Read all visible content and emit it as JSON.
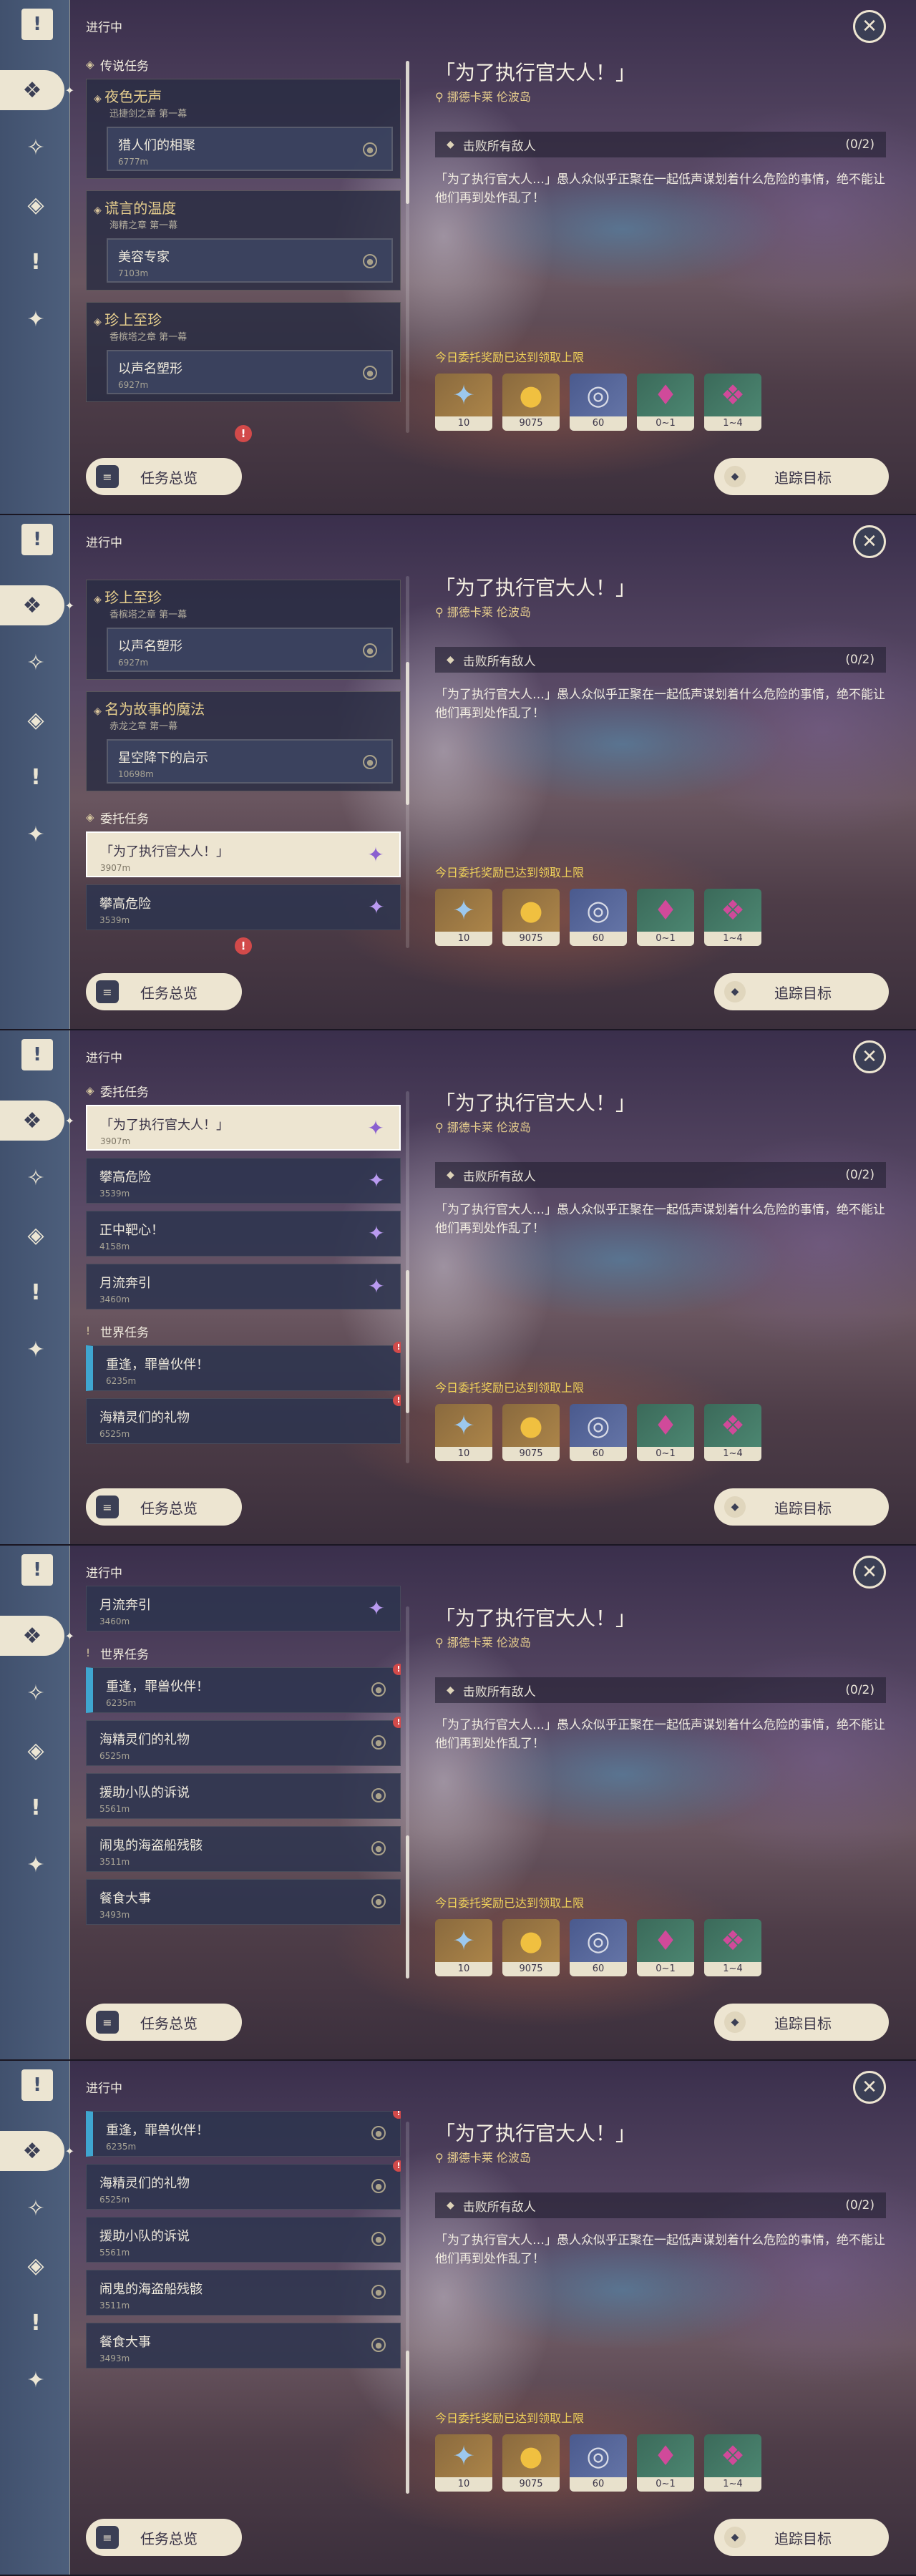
{
  "ui": {
    "header": "进行中",
    "overview_button": "任务总览",
    "track_button": "追踪目标",
    "close_icon": "✕"
  },
  "sections": {
    "legend": "传说任务",
    "commission": "委托任务",
    "world": "世界任务"
  },
  "legend_quests": [
    {
      "title": "夜色无声",
      "chapter": "迅捷剑之章 第一幕",
      "step": "猎人们的相聚",
      "dist": "6777m"
    },
    {
      "title": "谎言的温度",
      "chapter": "海精之章 第一幕",
      "step": "美容专家",
      "dist": "7103m"
    },
    {
      "title": "珍上至珍",
      "chapter": "香槟塔之章 第一幕",
      "step": "以声名塑形",
      "dist": "6927m"
    },
    {
      "title": "名为故事的魔法",
      "chapter": "赤龙之章 第一幕",
      "step": "星空降下的启示",
      "dist": "10698m"
    }
  ],
  "commissions": [
    {
      "name": "「为了执行官大人！」",
      "dist": "3907m"
    },
    {
      "name": "攀高危险",
      "dist": "3539m"
    },
    {
      "name": "正中靶心！",
      "dist": "4158m"
    },
    {
      "name": "月流奔引",
      "dist": "3460m"
    }
  ],
  "world_quests": [
    {
      "name": "重逢，罪兽伙伴！",
      "dist": "6235m"
    },
    {
      "name": "海精灵们的礼物",
      "dist": "6525m"
    },
    {
      "name": "援助小队的诉说",
      "dist": "5561m"
    },
    {
      "name": "闹鬼的海盗船残骸",
      "dist": "3511m"
    },
    {
      "name": "餐食大事",
      "dist": "3493m"
    }
  ],
  "detail": {
    "title": "「为了执行官大人！」",
    "location": "挪德卡莱 伦波岛",
    "objective": "击败所有敌人",
    "progress": "(0/2)",
    "description": "「为了执行官大人…」愚人众似乎正聚在一起低声谋划着什么危险的事情，绝不能让他们再到处作乱了！",
    "reward_notice": "今日委托奖励已达到领取上限"
  },
  "rewards": [
    {
      "icon": "adventure-exp-icon",
      "qty": "10"
    },
    {
      "icon": "mora-icon",
      "qty": "9075"
    },
    {
      "icon": "fate-icon",
      "qty": "60"
    },
    {
      "icon": "crystal-icon",
      "qty": "0~1"
    },
    {
      "icon": "crystal-cluster-icon",
      "qty": "1~4"
    }
  ],
  "colors": {
    "accent_gold": "#e8cf8e",
    "reward_notice": "#f0d25a",
    "world_quest_marker": "#3fa6d0",
    "alert": "#d24a4a"
  }
}
